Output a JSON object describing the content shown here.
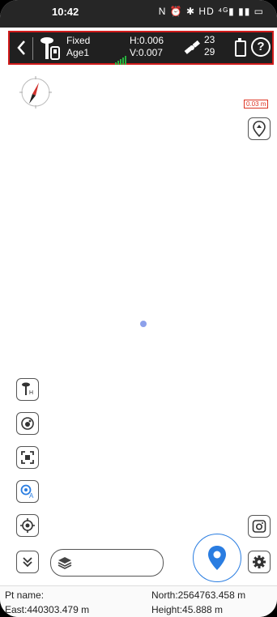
{
  "status_bar": {
    "time": "10:42",
    "icons": "N ⏰ ✱ HD ⁴ᴳ▮ ▮▮ ▭"
  },
  "header": {
    "fix_status": "Fixed",
    "age": "Age1",
    "h_precision": "H:0.006",
    "v_precision": "V:0.007",
    "sats_used": "23",
    "sats_total": "29",
    "help_symbol": "?"
  },
  "map": {
    "scale_label": "0.03 m"
  },
  "footer": {
    "pt_name_label": "Pt name:",
    "east": "East:440303.479 m",
    "north": "North:2564763.458 m",
    "height": "Height:45.888 m"
  },
  "colors": {
    "accent": "#2a7de1",
    "header_border": "#d11b1b",
    "signal": "#27b43e",
    "position_dot": "#8ca0ea"
  }
}
